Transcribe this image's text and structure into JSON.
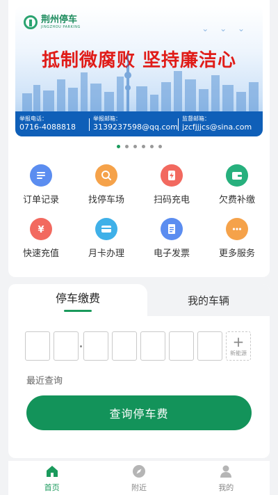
{
  "banner": {
    "logo_cn": "荆州停车",
    "logo_en": "JINGZHOU PARKING",
    "slogan": "抵制微腐败 坚持廉洁心",
    "contacts": [
      {
        "label": "举报电话：",
        "value": "0716-4088818"
      },
      {
        "label": "举报邮箱：",
        "value": "3139237598@qq.com"
      },
      {
        "label": "监督邮箱：",
        "value": "jzcfjjjcs@sina.com"
      }
    ],
    "page_dots": 6,
    "active_dot": 0
  },
  "services": [
    {
      "label": "订单记录",
      "icon": "list-icon",
      "color": "#5b8df0"
    },
    {
      "label": "找停车场",
      "icon": "search-icon",
      "color": "#f5a24a"
    },
    {
      "label": "扫码充电",
      "icon": "charge-icon",
      "color": "#f2695f"
    },
    {
      "label": "欠费补缴",
      "icon": "wallet-icon",
      "color": "#27b07d"
    },
    {
      "label": "快速充值",
      "icon": "yuan-icon",
      "color": "#f2695f"
    },
    {
      "label": "月卡办理",
      "icon": "card-icon",
      "color": "#3fb0e8"
    },
    {
      "label": "电子发票",
      "icon": "invoice-icon",
      "color": "#5b8df0"
    },
    {
      "label": "更多服务",
      "icon": "more-icon",
      "color": "#f5a24a"
    }
  ],
  "parking": {
    "tab_active": "停车缴费",
    "tab_inactive": "我的车辆",
    "new_energy_label": "新能源",
    "recent_label": "最近查询",
    "query_button": "查询停车费"
  },
  "tabbar": {
    "items": [
      {
        "label": "首页",
        "icon": "home-icon",
        "active": true
      },
      {
        "label": "附近",
        "icon": "compass-icon",
        "active": false
      },
      {
        "label": "我的",
        "icon": "user-icon",
        "active": false
      }
    ],
    "active_color": "#1a9a5c"
  }
}
